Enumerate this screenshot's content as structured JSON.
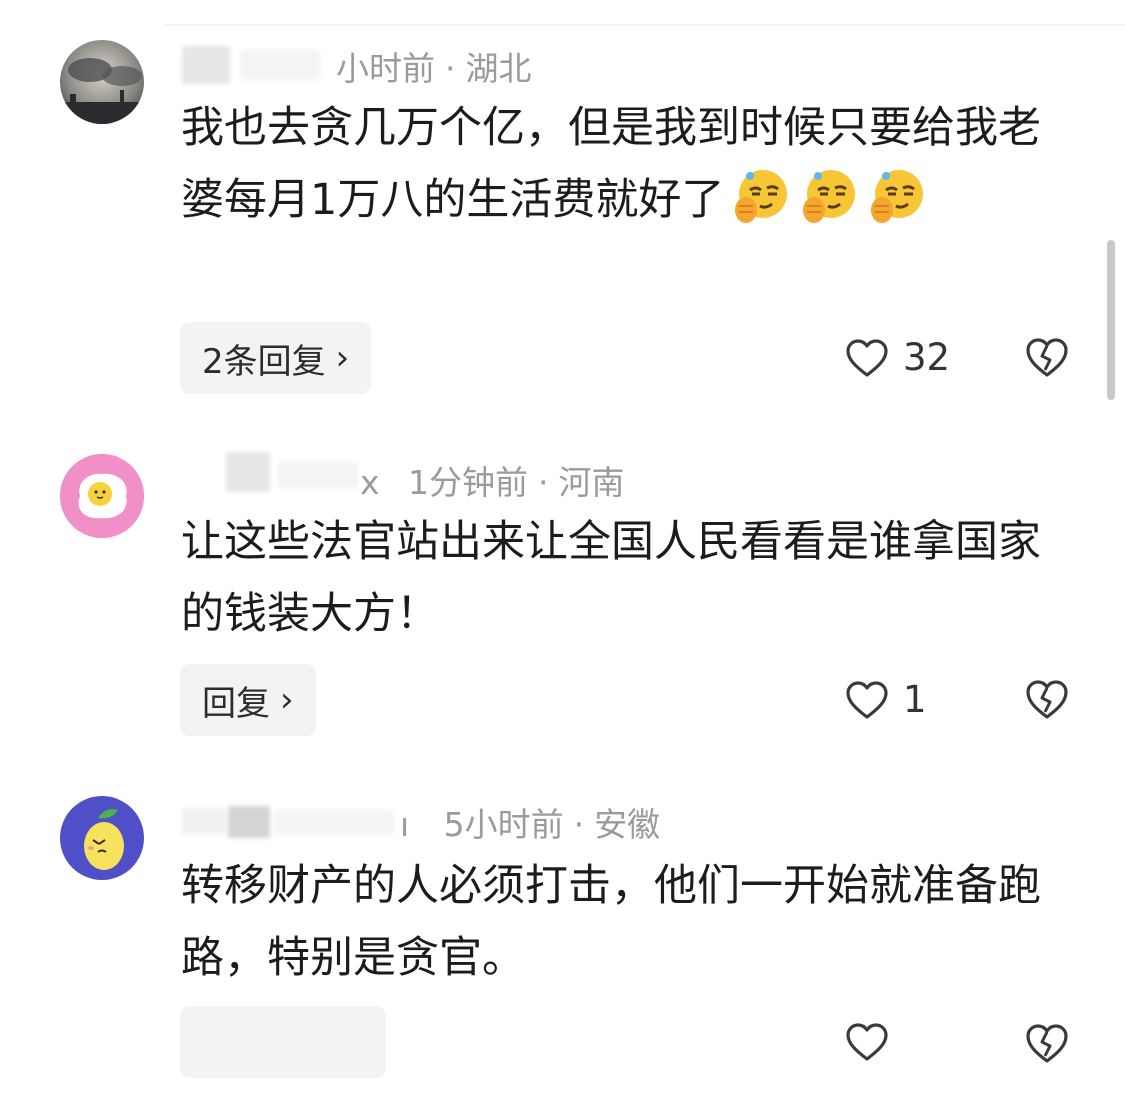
{
  "comments": [
    {
      "username_visible": "",
      "time": "小时前",
      "location": "湖北",
      "text": "我也去贪几万个亿，但是我到时候只要给我老婆每月1万八的生活费就好了",
      "emoji_count": 3,
      "replies_label": "2条回复",
      "likes": "32"
    },
    {
      "username_visible": "x",
      "time": "1分钟前",
      "location": "河南",
      "text": "让这些法官站出来让全国人民看看是谁拿国家的钱装大方！",
      "replies_label": "回复",
      "likes": "1"
    },
    {
      "username_visible": "ı",
      "time": "5小时前",
      "location": "安徽",
      "text": "转移财产的人必须打击，他们一开始就准备跑路，特别是贪官。",
      "replies_label": "",
      "likes": ""
    }
  ],
  "icons": {
    "like": "heart-outline-icon",
    "dislike": "broken-heart-icon",
    "chevron": "chevron-right-icon",
    "emoji": "smirk-thumb-emoji"
  },
  "separator": "·",
  "chevron_glyph": "›"
}
